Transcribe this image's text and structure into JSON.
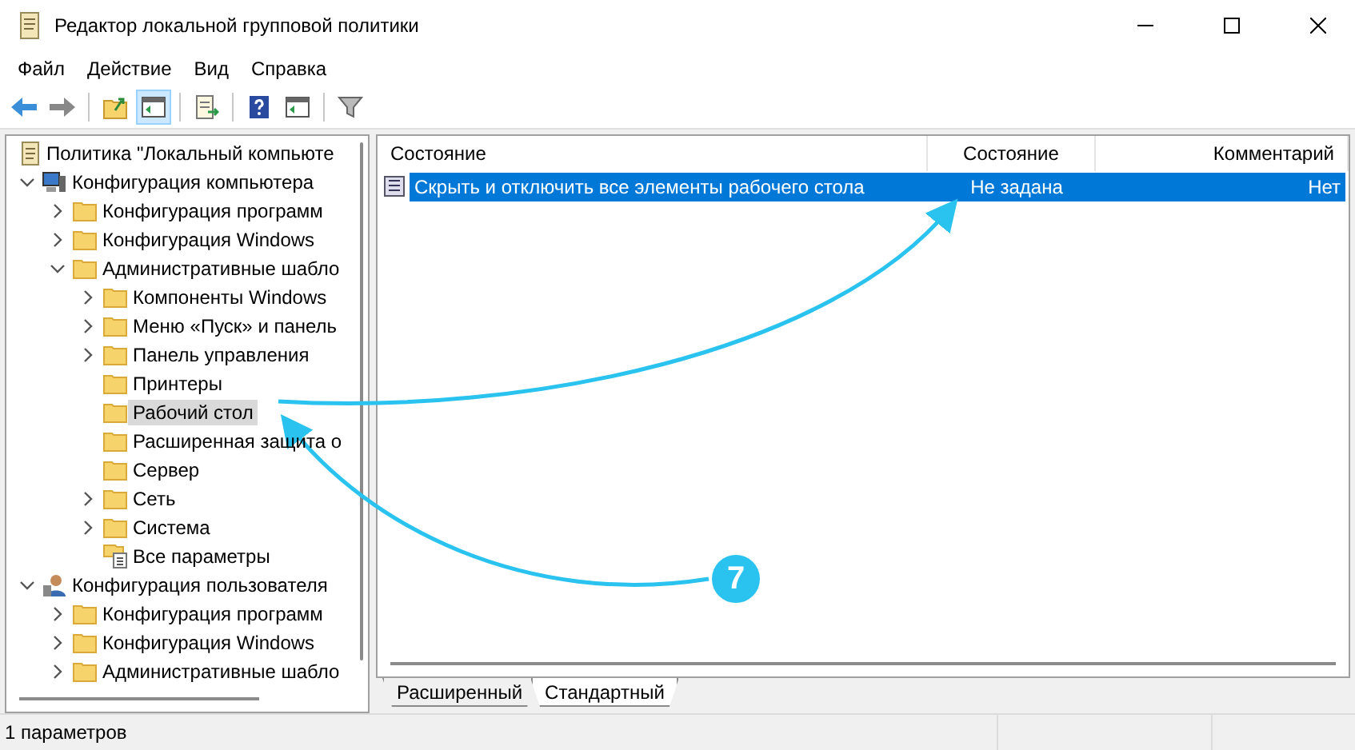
{
  "window": {
    "title": "Редактор локальной групповой политики"
  },
  "menu": [
    "Файл",
    "Действие",
    "Вид",
    "Справка"
  ],
  "toolbar": [
    {
      "kind": "back"
    },
    {
      "kind": "forward"
    },
    {
      "kind": "sep"
    },
    {
      "kind": "up"
    },
    {
      "kind": "panel",
      "selected": true
    },
    {
      "kind": "sep"
    },
    {
      "kind": "export"
    },
    {
      "kind": "sep"
    },
    {
      "kind": "help"
    },
    {
      "kind": "panel2",
      "selected": false
    },
    {
      "kind": "sep"
    },
    {
      "kind": "filter"
    }
  ],
  "tree": [
    {
      "label": "Политика \"Локальный компьюте",
      "kind": "policy",
      "selected": false,
      "children": [
        {
          "label": "Конфигурация компьютера",
          "kind": "computer",
          "expanded": true,
          "selected": false,
          "children": [
            {
              "label": "Конфигурация программ",
              "expanded": false,
              "selected": false
            },
            {
              "label": "Конфигурация Windows",
              "expanded": false,
              "selected": false
            },
            {
              "label": "Административные шабло",
              "expanded": true,
              "selected": false,
              "children": [
                {
                  "label": "Компоненты Windows",
                  "expanded": false,
                  "selected": false
                },
                {
                  "label": "Меню «Пуск» и панель",
                  "expanded": false,
                  "selected": false
                },
                {
                  "label": "Панель управления",
                  "expanded": false,
                  "selected": false
                },
                {
                  "label": "Принтеры",
                  "selected": false
                },
                {
                  "label": "Рабочий стол",
                  "selected": true
                },
                {
                  "label": "Расширенная защита о",
                  "selected": false
                },
                {
                  "label": "Сервер",
                  "selected": false
                },
                {
                  "label": "Сеть",
                  "expanded": false,
                  "selected": false
                },
                {
                  "label": "Система",
                  "expanded": false,
                  "selected": false
                },
                {
                  "label": "Все параметры",
                  "kind": "settings",
                  "selected": false
                }
              ]
            }
          ]
        },
        {
          "label": "Конфигурация пользователя",
          "kind": "user",
          "expanded": true,
          "selected": false,
          "children": [
            {
              "label": "Конфигурация программ",
              "expanded": false,
              "selected": false
            },
            {
              "label": "Конфигурация Windows",
              "expanded": false,
              "selected": false
            },
            {
              "label": "Административные шабло",
              "expanded": false,
              "selected": false
            }
          ]
        }
      ]
    }
  ],
  "table": {
    "columns": [
      "Состояние",
      "Состояние",
      "Комментарий"
    ],
    "rows": [
      {
        "cells": [
          "Скрыть и отключить все элементы рабочего стола",
          "Не задана",
          "Нет"
        ],
        "selected": true
      }
    ]
  },
  "tabs": [
    {
      "label": "Расширенный",
      "selected": false
    },
    {
      "label": "Стандартный",
      "selected": true
    }
  ],
  "status_bar": "1 параметров",
  "annotation": {
    "badge": "7"
  }
}
